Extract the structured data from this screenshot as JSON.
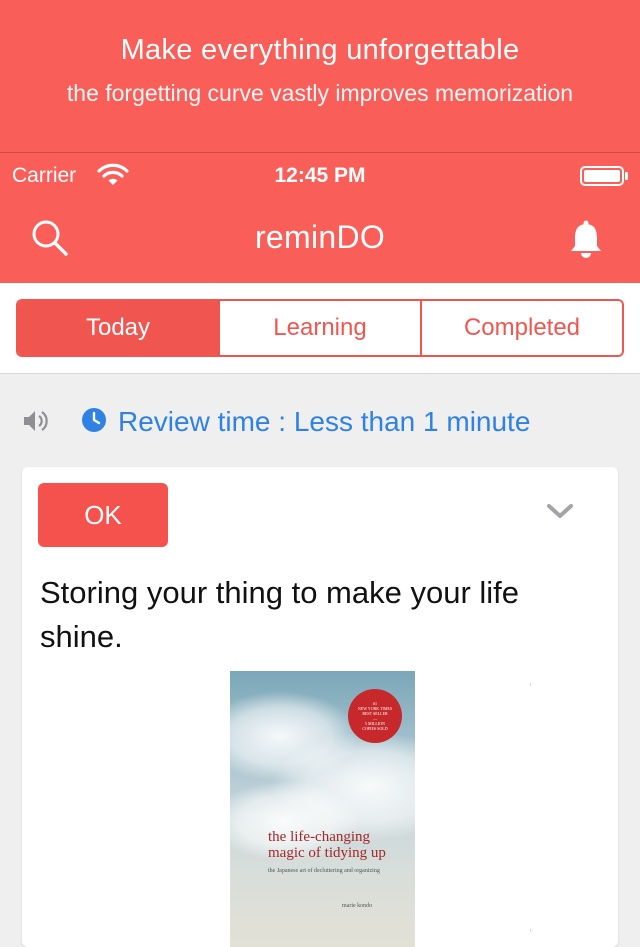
{
  "promo": {
    "title": "Make everything unforgettable",
    "subtitle": "the forgetting curve vastly improves memorization"
  },
  "status_bar": {
    "carrier": "Carrier",
    "time": "12:45 PM",
    "wifi_icon": "wifi-icon",
    "battery_icon": "battery-icon"
  },
  "nav": {
    "title": "reminDO",
    "search_icon": "search-icon",
    "bell_icon": "bell-icon"
  },
  "tabs": [
    {
      "label": "Today",
      "active": true
    },
    {
      "label": "Learning",
      "active": false
    },
    {
      "label": "Completed",
      "active": false
    }
  ],
  "review": {
    "text": "Review time : Less than 1 minute",
    "speaker_icon": "speaker-icon",
    "clock_icon": "clock-icon"
  },
  "card": {
    "ok_label": "OK",
    "text": "Storing your thing to make your life shine.",
    "chevron_icon": "chevron-down-icon",
    "book": {
      "badge_lines": [
        "#1",
        "NEW YORK TIMES",
        "BEST SELLER",
        "—",
        "5 MILLION",
        "COPIES SOLD"
      ],
      "title": "the life-changing magic of tidying up",
      "subtitle": "the Japanese art of decluttering and organizing",
      "author": "marie kondo"
    }
  },
  "colors": {
    "brand": "#fa5e58",
    "segment_accent": "#f0564f",
    "link_blue": "#2f82e4",
    "ok_button": "#f5514d",
    "background": "#efeff0"
  }
}
